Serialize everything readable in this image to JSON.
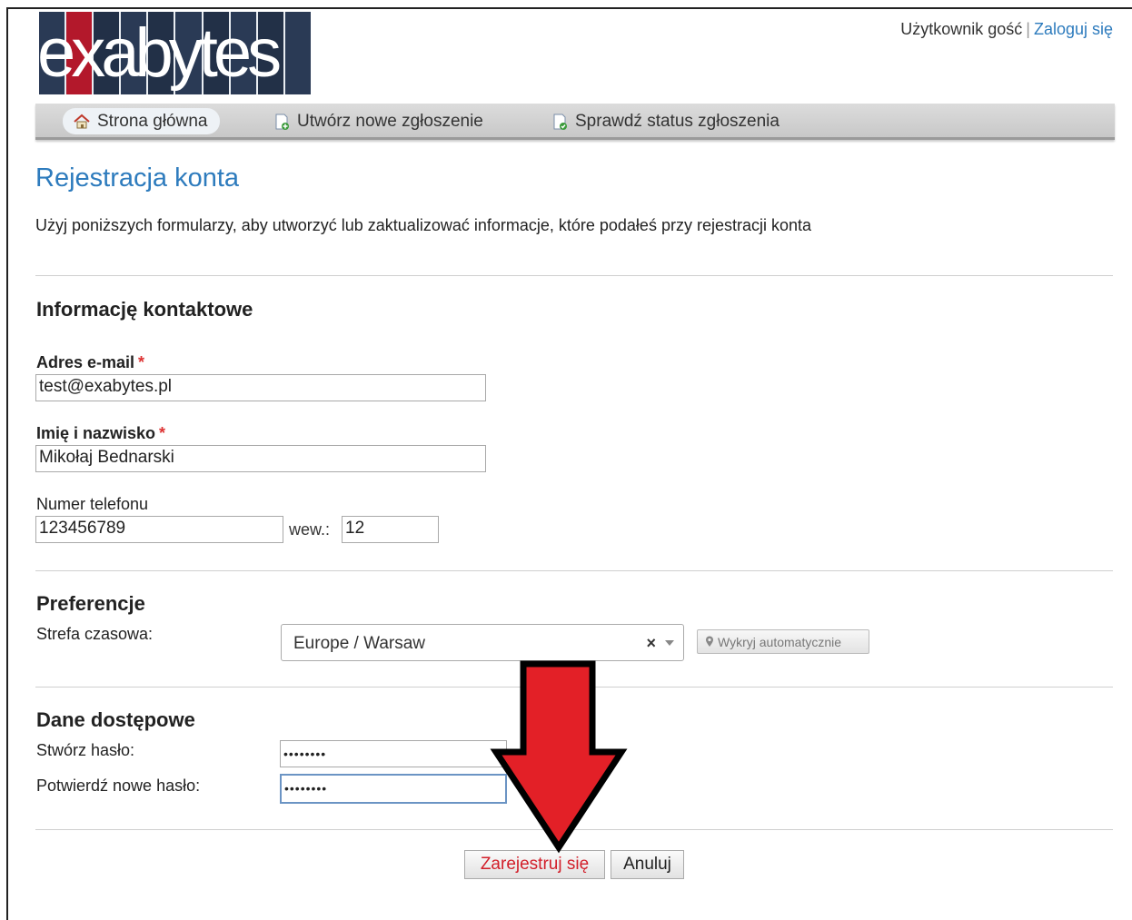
{
  "header": {
    "logo_text": "exabytes",
    "user_label": "Użytkownik gość",
    "separator": "|",
    "login_link": "Zaloguj się"
  },
  "nav": {
    "items": [
      {
        "label": "Strona główna",
        "icon": "home-icon",
        "active": true
      },
      {
        "label": "Utwórz nowe zgłoszenie",
        "icon": "new-ticket-icon",
        "active": false
      },
      {
        "label": "Sprawdź status zgłoszenia",
        "icon": "ticket-status-icon",
        "active": false
      }
    ]
  },
  "page": {
    "title": "Rejestracja konta",
    "intro": "Użyj poniższych formularzy, aby utworzyć lub zaktualizować informacje, które podałeś przy rejestracji konta"
  },
  "contact": {
    "heading": "Informację kontaktowe",
    "email_label": "Adres e-mail",
    "email_value": "test@exabytes.pl",
    "name_label": "Imię i nazwisko",
    "name_value": "Mikołaj Bednarski",
    "required_mark": "*",
    "phone_label": "Numer telefonu",
    "phone_value": "123456789",
    "ext_label": "wew.:",
    "ext_value": "12"
  },
  "preferences": {
    "heading": "Preferencje",
    "timezone_label": "Strefa czasowa:",
    "timezone_value": "Europe / Warsaw",
    "clear_symbol": "×",
    "detect_button": "Wykryj automatycznie"
  },
  "access": {
    "heading": "Dane dostępowe",
    "password_label": "Stwórz hasło:",
    "password_value": "••••••••",
    "confirm_label": "Potwierdź nowe hasło:",
    "confirm_value": "••••••••"
  },
  "actions": {
    "register": "Zarejestruj się",
    "cancel": "Anuluj"
  },
  "colors": {
    "link": "#2d7bbd",
    "register_text": "#d21f2a",
    "arrow": "#e32027"
  }
}
